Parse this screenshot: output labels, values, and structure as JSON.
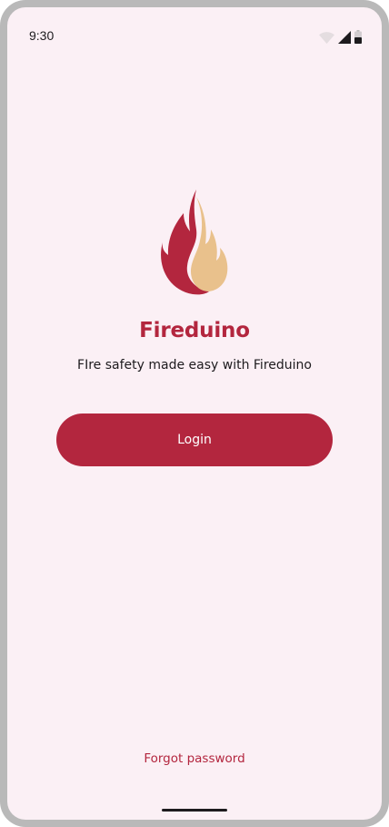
{
  "status_bar": {
    "time": "9:30",
    "icons": [
      "wifi-icon",
      "cellular-signal-icon",
      "battery-icon"
    ]
  },
  "app": {
    "name": "Fireduino",
    "tagline": "FIre safety made easy with Fireduino",
    "logo_icon": "flame-logo-icon"
  },
  "actions": {
    "login_label": "Login",
    "forgot_password_label": "Forgot password"
  },
  "colors": {
    "brand": "#b3263e",
    "flame_light": "#e9c18c",
    "background": "#fbf0f5",
    "text": "#1d1b1e"
  }
}
